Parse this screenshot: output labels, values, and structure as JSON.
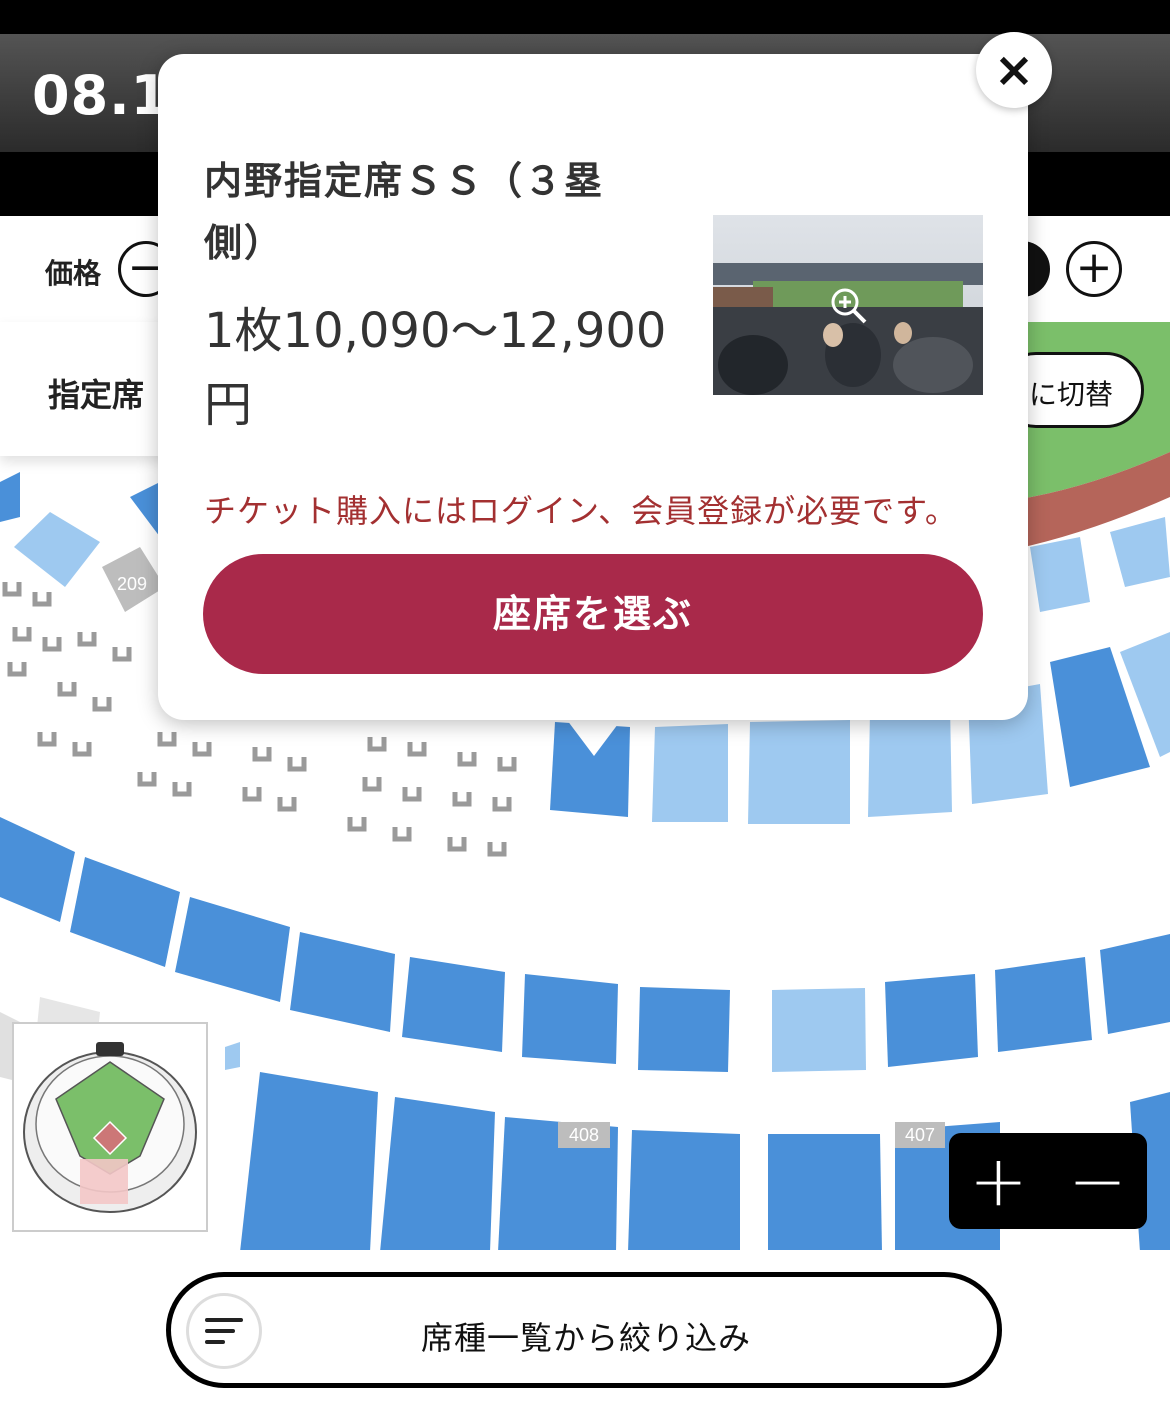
{
  "header": {
    "date": "08.1"
  },
  "filters": {
    "price_label": "価格",
    "minus": "−",
    "plus": "+"
  },
  "seat_panel": {
    "title": "指定席",
    "switch_label": "に切替"
  },
  "map": {
    "section_labels": [
      "209",
      "408",
      "407"
    ],
    "colors": {
      "dark": "#4a90d9",
      "light": "#9ec9f0",
      "grey": "#c8c8c8",
      "field": "#7bbf6a",
      "dirt": "#b5655a"
    }
  },
  "popup": {
    "close": "×",
    "title": "内野指定席ＳＳ（３塁側）",
    "price": "1枚10,090〜12,900円",
    "zoom_icon": "zoom-in-icon",
    "notice": "チケット購入にはログイン、会員登録が必要です。",
    "cta": "座席を選ぶ",
    "cta_color": "#a9294a"
  },
  "zoom": {
    "in": "+",
    "out": "−"
  },
  "bottom": {
    "filter_label": "席種一覧から絞り込み",
    "filter_icon": "filter-lines-icon"
  }
}
